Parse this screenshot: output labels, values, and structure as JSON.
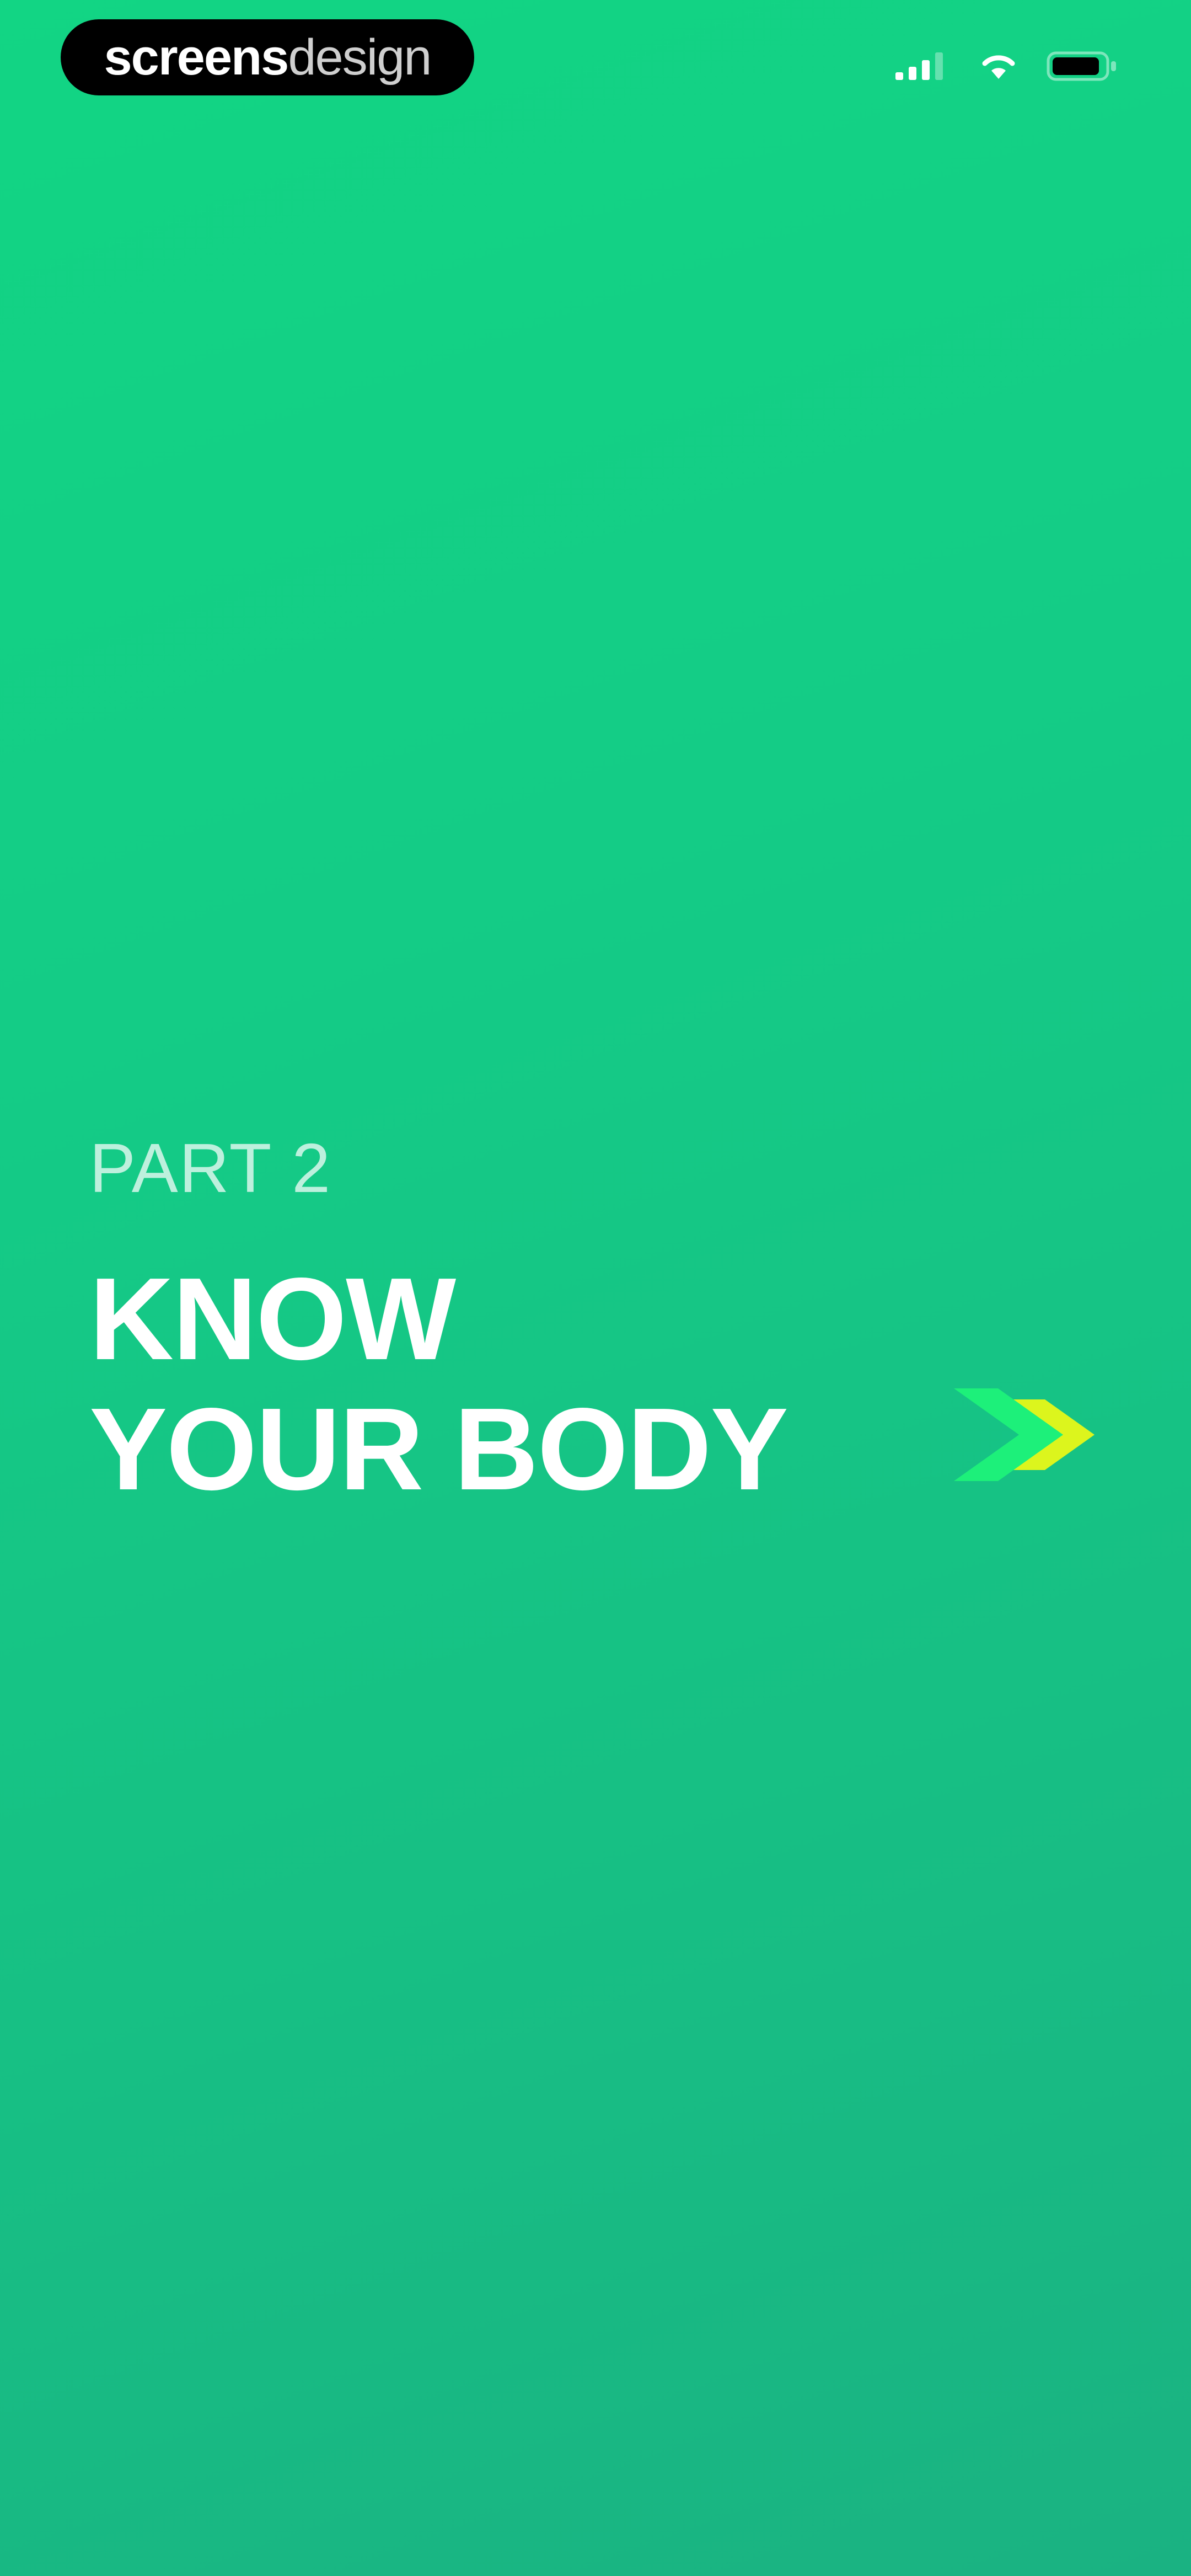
{
  "brand": {
    "strong": "screens",
    "light": "design"
  },
  "status_bar": {
    "icons": [
      "cellular-signal-icon",
      "wifi-icon",
      "battery-icon"
    ]
  },
  "onboarding": {
    "part_label": "PART 2",
    "headline_line_1": "KNOW",
    "headline_line_2": "YOUR BODY",
    "next_icon": "chevron-right-icon"
  },
  "colors": {
    "background_start": "#12d584",
    "background_end": "#1ab282",
    "chevron_green": "#1df07a",
    "chevron_yellow": "#dcf51d",
    "text": "#ffffff"
  }
}
